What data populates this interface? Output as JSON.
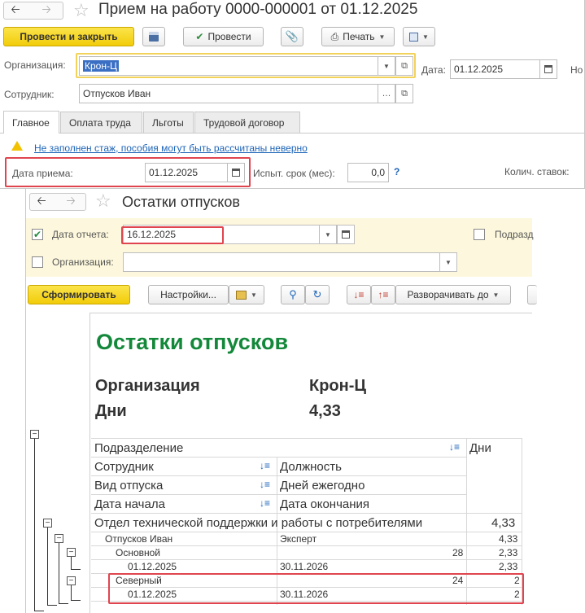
{
  "doc_window": {
    "title": "Прием на работу 0000-000001 от 01.12.2025",
    "toolbar": {
      "post_close": "Провести и закрыть",
      "post": "Провести",
      "print": "Печать"
    },
    "org_label": "Организация:",
    "org_value": "Крон-Ц",
    "date_label": "Дата:",
    "date_value": "01.12.2025",
    "no_label_cut": "Но",
    "employee_label": "Сотрудник:",
    "employee_value": "Отпусков Иван",
    "tabs": [
      "Главное",
      "Оплата труда",
      "Льготы",
      "Трудовой договор"
    ],
    "warning_text": "Не заполнен стаж, пособия могут быть рассчитаны неверно",
    "hire_date_label": "Дата приема:",
    "hire_date_value": "01.12.2025",
    "probation_label": "Испыт. срок (мес):",
    "probation_value": "0,0",
    "help_mark": "?",
    "rates_label": "Колич. ставок:"
  },
  "report_window": {
    "title": "Остатки отпусков",
    "report_date_label": "Дата отчета:",
    "report_date_value": "16.12.2025",
    "org_label": "Организация:",
    "org_value": "",
    "subdiv_label_cut": "Подразд",
    "toolbar": {
      "generate": "Сформировать",
      "settings": "Настройки...",
      "expand": "Разворачивать до"
    },
    "report": {
      "heading": "Остатки отпусков",
      "org_label": "Организация",
      "org_value": "Крон-Ц",
      "days_label": "Дни",
      "days_value": "4,33",
      "table_header": {
        "subdivision": "Подразделение",
        "days": "Дни",
        "employee": "Сотрудник",
        "position": "Должность",
        "vacation_type": "Вид отпуска",
        "days_per_year": "Дней ежегодно",
        "start_date": "Дата начала",
        "end_date": "Дата окончания"
      },
      "rows": {
        "dept_name": "Отдел технической поддержки и работы с потребителями",
        "dept_days": "4,33",
        "emp_name": "Отпусков Иван",
        "emp_position": "Эксперт",
        "emp_days": "4,33",
        "main_type": "Основной",
        "main_per_year": "28",
        "main_days": "2,33",
        "main_start": "01.12.2025",
        "main_end": "30.11.2026",
        "main_sub_days": "2,33",
        "north_type": "Северный",
        "north_per_year": "24",
        "north_days": "2",
        "north_start": "01.12.2025",
        "north_end": "30.11.2026",
        "north_sub_days": "2"
      }
    }
  }
}
